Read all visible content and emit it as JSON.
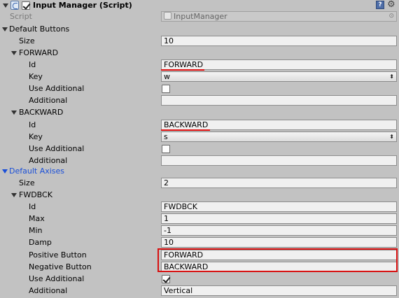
{
  "header": {
    "title": "Input Manager (Script)",
    "enabled": true,
    "help_glyph": "?",
    "gear_glyph": "⚙",
    "icons": [
      "script-icon",
      "help-icon",
      "gear-icon"
    ]
  },
  "script_row": {
    "label": "Script",
    "value": "InputManager",
    "picker_glyph": "⊙"
  },
  "default_buttons": {
    "label": "Default Buttons",
    "size_label": "Size",
    "size_value": "10",
    "forward": {
      "label": "FORWARD",
      "id_label": "Id",
      "id_value": "FORWARD",
      "key_label": "Key",
      "key_value": "w",
      "use_additional_label": "Use Additional",
      "use_additional": false,
      "additional_label": "Additional",
      "additional_value": ""
    },
    "backward": {
      "label": "BACKWARD",
      "id_label": "Id",
      "id_value": "BACKWARD",
      "key_label": "Key",
      "key_value": "s",
      "use_additional_label": "Use Additional",
      "use_additional": false,
      "additional_label": "Additional",
      "additional_value": ""
    }
  },
  "default_axes": {
    "label": "Default Axises",
    "size_label": "Size",
    "size_value": "2",
    "fwdbck": {
      "label": "FWDBCK",
      "id_label": "Id",
      "id_value": "FWDBCK",
      "max_label": "Max",
      "max_value": "1",
      "min_label": "Min",
      "min_value": "-1",
      "damp_label": "Damp",
      "damp_value": "10",
      "positive_label": "Positive Button",
      "positive_value": "FORWARD",
      "negative_label": "Negative Button",
      "negative_value": "BACKWARD",
      "use_additional_label": "Use Additional",
      "use_additional": true,
      "additional_label": "Additional",
      "additional_value": "Vertical"
    }
  },
  "dropdown_arrow": "⬍",
  "colors": {
    "background": "#c2c2c2",
    "highlight": "#e01010",
    "section_blue": "#1a4fd8"
  }
}
